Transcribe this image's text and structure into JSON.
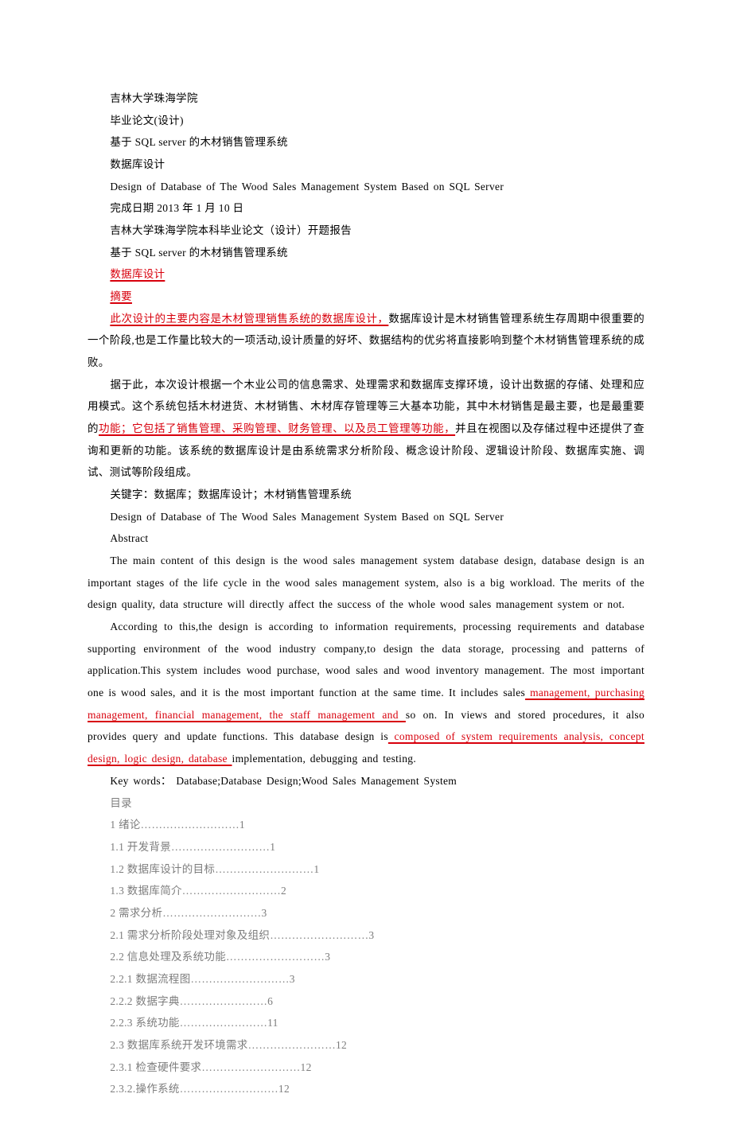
{
  "header": {
    "school": "吉林大学珠海学院",
    "doc_type": "毕业论文(设计)",
    "title_cn_1": "基于 SQL server 的木材销售管理系统",
    "title_cn_2": "数据库设计",
    "title_en": "Design of Database of The Wood Sales Management System Based on SQL Server",
    "date": "完成日期 2013 年 1 月 10 日",
    "proposal": "吉林大学珠海学院本科毕业论文（设计）开题报告",
    "title_cn_3": "基于 SQL server 的木材销售管理系统",
    "title_cn_4": "数据库设计",
    "abstract_label_cn": "摘要"
  },
  "abstract_cn": {
    "s1_hl": "此次设计的主要内容是木材管理销售系统的数据库设计，",
    "s1_b": "数据库设计是木材销售管理系统生存周期中很重要的一个阶段,也是工作量比较大的一项活动,设计质量的好坏、数据结构的优劣将直接影响到整个木材销售管理系统的成败。",
    "s2_a": "据于此，本次设计根据一个木业公司的信息需求、处理需求和数据库支撑环境，设计出数据的存储、处理和应用模式。这个系统包括木材进货、木材销售、木材库存管理等三大基本功能，其中木材销售是最主要，也是最重要的",
    "s2_hl": "功能；它包括了销售管理、采购管理、财务管理、以及员工管理等功能，",
    "s2_b": "并且在视图以及存储过程中还提供了查询和更新的功能。该系统的数据库设计是由系统需求分析阶段、概念设计阶段、逻辑设计阶段、数据库实施、调试、测试等阶段组成。",
    "keywords": "关键字：数据库；数据库设计；木材销售管理系统"
  },
  "abstract_en": {
    "title": "Design of Database of The Wood Sales Management System Based on SQL Server",
    "label": "Abstract",
    "p1": "The main content of this design is the wood sales management system database design, database design is an important stages of the life cycle in the wood sales management system, also is a big workload. The merits of the design quality, data structure will directly affect the success of the whole wood sales management system or not.",
    "p2_a": "According to this,the design is according to information requirements, processing requirements and database supporting environment of the wood industry company,to design the data storage, processing and patterns of application.This system includes wood purchase, wood sales and wood inventory management. The most important one is wood sales, and it is the most important function at the same time. It includes sales",
    "p2_hl1": " management, purchasing management, financial management, the staff management and ",
    "p2_b": "so on. In views and stored procedures, it also provides query and update functions. This database design is",
    "p2_hl2": " composed of system requirements analysis, concept design, logic design, database ",
    "p2_c": "implementation, debugging and testing.",
    "keywords": "Key words： Database;Database Design;Wood Sales Management System"
  },
  "toc": {
    "label": "目录",
    "items": [
      {
        "t": "1 绪论",
        "d": "………………………",
        "p": "1"
      },
      {
        "t": "1.1 开发背景",
        "d": "………………………",
        "p": "1"
      },
      {
        "t": "1.2 数据库设计的目标",
        "d": "………………………",
        "p": "1"
      },
      {
        "t": "1.3 数据库简介",
        "d": "………………………",
        "p": "2"
      },
      {
        "t": "2 需求分析",
        "d": "………………………",
        "p": "3"
      },
      {
        "t": "2.1 需求分析阶段处理对象及组织",
        "d": "………………………",
        "p": "3"
      },
      {
        "t": "2.2 信息处理及系统功能",
        "d": "………………………",
        "p": "3"
      },
      {
        "t": "2.2.1 数据流程图",
        "d": "………………………",
        "p": "3"
      },
      {
        "t": "2.2.2 数据字典",
        "d": "……………………",
        "p": "6"
      },
      {
        "t": "2.2.3 系统功能",
        "d": "……………………",
        "p": "11"
      },
      {
        "t": "2.3 数据库系统开发环境需求",
        "d": "……………………",
        "p": "12"
      },
      {
        "t": "2.3.1 检查硬件要求",
        "d": "………………………",
        "p": "12"
      },
      {
        "t": "2.3.2.操作系统",
        "d": "………………………",
        "p": "12"
      }
    ]
  }
}
